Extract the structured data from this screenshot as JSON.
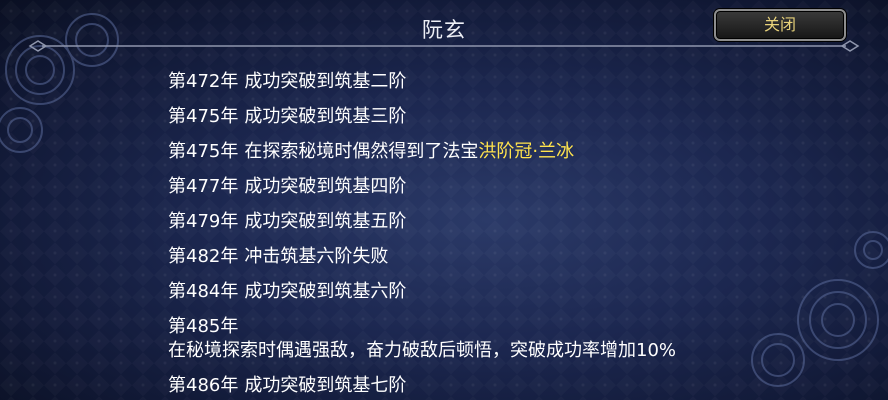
{
  "header": {
    "title": "阮玄",
    "close_label": "关闭"
  },
  "log": {
    "entries": [
      {
        "year": "第472年",
        "text": "成功突破到筑基二阶"
      },
      {
        "year": "第475年",
        "text": "成功突破到筑基三阶"
      },
      {
        "year": "第475年",
        "text": "在探索秘境时偶然得到了法宝",
        "highlight": "洪阶冠·兰冰"
      },
      {
        "year": "第477年",
        "text": "成功突破到筑基四阶"
      },
      {
        "year": "第479年",
        "text": "成功突破到筑基五阶"
      },
      {
        "year": "第482年",
        "text": "冲击筑基六阶失败"
      },
      {
        "year": "第484年",
        "text": "成功突破到筑基六阶"
      },
      {
        "year": "第485年",
        "text": "",
        "line2": "在秘境探索时偶遇强敌，奋力破敌后顿悟，突破成功率增加10%"
      },
      {
        "year": "第486年",
        "text": "成功突破到筑基七阶"
      }
    ]
  },
  "colors": {
    "highlight": "#ffe34d",
    "close_text": "#e8d27a",
    "background": "#1c2750"
  },
  "icons": {
    "divider": "ornate-divider-icon",
    "swirl": "cloud-swirl-icon"
  }
}
